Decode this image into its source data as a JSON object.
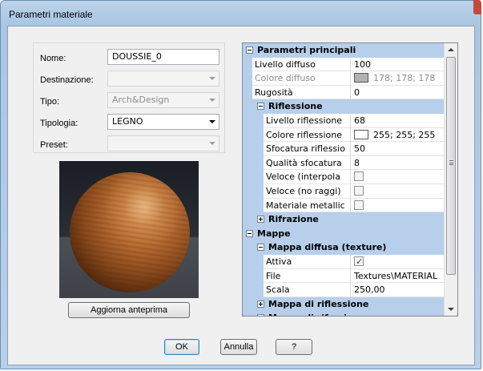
{
  "window": {
    "title": "Parametri materiale"
  },
  "form": {
    "fields": [
      {
        "label": "Nome:",
        "value": "DOUSSIE_0",
        "type": "text",
        "enabled": true
      },
      {
        "label": "Destinazione:",
        "value": "",
        "type": "dropdown",
        "enabled": false
      },
      {
        "label": "Tipo:",
        "value": "Arch&Design",
        "type": "dropdown",
        "enabled": false
      },
      {
        "label": "Tipologia:",
        "value": "LEGNO",
        "type": "dropdown",
        "enabled": true
      },
      {
        "label": "Preset:",
        "value": "",
        "type": "dropdown",
        "enabled": false
      }
    ]
  },
  "preview": {
    "update_button": "Aggiorna anteprima"
  },
  "property_grid": {
    "rows": [
      {
        "kind": "cat",
        "level": 0,
        "expanded": true,
        "label": "Parametri principali"
      },
      {
        "kind": "prop",
        "level": 0,
        "name": "Livello diffuso",
        "value": "100"
      },
      {
        "kind": "prop",
        "level": 0,
        "name": "Colore diffuso",
        "value": "178; 178; 178",
        "swatch": "#b2b2b2",
        "disabled": true
      },
      {
        "kind": "prop",
        "level": 0,
        "name": "Rugosità",
        "value": "0"
      },
      {
        "kind": "cat",
        "level": 1,
        "expanded": true,
        "label": "Riflessione"
      },
      {
        "kind": "prop",
        "level": 1,
        "name": "Livello riflessione",
        "value": "68"
      },
      {
        "kind": "prop",
        "level": 1,
        "name": "Colore riflessione",
        "value": "255; 255; 255",
        "swatch": "#ffffff"
      },
      {
        "kind": "prop",
        "level": 1,
        "name": "Sfocatura riflessio",
        "value": "50"
      },
      {
        "kind": "prop",
        "level": 1,
        "name": "Qualità sfocatura",
        "value": "8"
      },
      {
        "kind": "prop",
        "level": 1,
        "name": "Veloce (interpola",
        "checkbox": false
      },
      {
        "kind": "prop",
        "level": 1,
        "name": "Veloce (no raggi)",
        "checkbox": false
      },
      {
        "kind": "prop",
        "level": 1,
        "name": "Materiale metallic",
        "checkbox": false
      },
      {
        "kind": "cat",
        "level": 1,
        "expanded": false,
        "label": "Rifrazione"
      },
      {
        "kind": "cat",
        "level": 0,
        "expanded": true,
        "label": "Mappe"
      },
      {
        "kind": "cat",
        "level": 1,
        "expanded": true,
        "label": "Mappa diffusa (texture)"
      },
      {
        "kind": "prop",
        "level": 1,
        "name": "Attiva",
        "checkbox": true
      },
      {
        "kind": "prop",
        "level": 1,
        "name": "File",
        "value": "Textures\\MATERIAL"
      },
      {
        "kind": "prop",
        "level": 1,
        "name": "Scala",
        "value": "250,00"
      },
      {
        "kind": "cat",
        "level": 1,
        "expanded": false,
        "label": "Mappa di riflessione"
      },
      {
        "kind": "cat",
        "level": 1,
        "expanded": false,
        "label": "Mappa di rifrazione"
      }
    ]
  },
  "buttons": {
    "ok": "OK",
    "cancel": "Annulla",
    "help": "?"
  }
}
